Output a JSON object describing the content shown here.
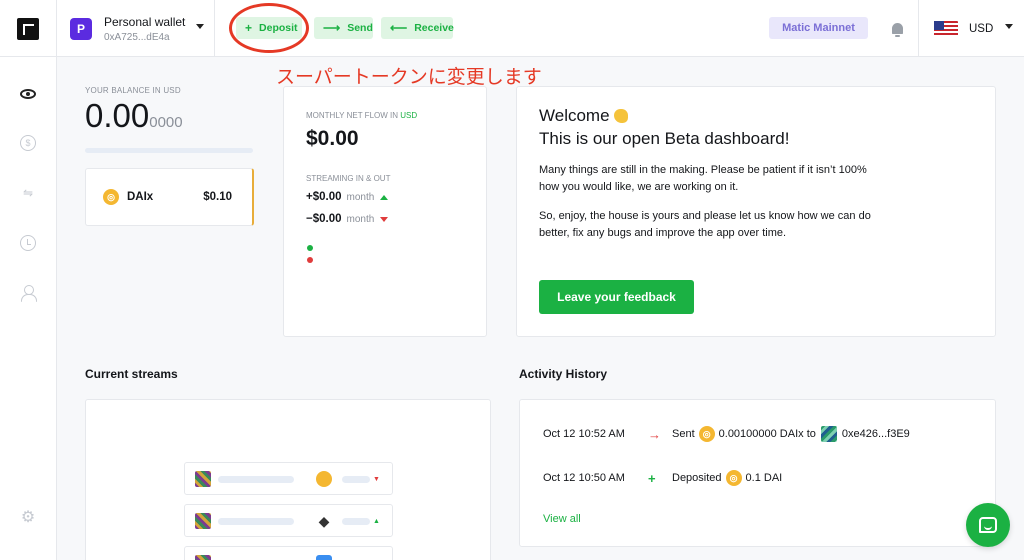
{
  "wallet": {
    "avatar_letter": "P",
    "name": "Personal wallet",
    "address": "0xA725...dE4a"
  },
  "toolbar": {
    "deposit": {
      "icon": "+",
      "label": "Deposit"
    },
    "send": {
      "icon": "⟶",
      "label": "Send"
    },
    "receive": {
      "icon": "⟵",
      "label": "Receive"
    }
  },
  "network": "Matic Mainnet",
  "currency": "USD",
  "annotation": {
    "text": "スーパートークンに変更します",
    "color": "#e53925"
  },
  "balance": {
    "label": "YOUR BALANCE IN USD",
    "main": "0.00",
    "decimals": "0000"
  },
  "token": {
    "name": "DAIx",
    "value": "$0.10"
  },
  "netflow": {
    "label": "MONTHLY NET FLOW IN",
    "currency": "USD",
    "value": "$0.00",
    "streaming_label": "STREAMING IN & OUT",
    "in_value": "+$0.00",
    "in_period": "month",
    "out_value": "−$0.00",
    "out_period": "month"
  },
  "welcome": {
    "title": "Welcome",
    "subtitle": "This is our open Beta dashboard!",
    "p1": "Many things are still in the making. Please be patient if it isn’t 100% how you would like, we are working on it.",
    "p2": "So, enjoy, the house is yours and please let us know how we can do better, fix any bugs and improve the app over time.",
    "button": "Leave your feedback"
  },
  "streams": {
    "title": "Current streams"
  },
  "activity": {
    "title": "Activity History",
    "items": [
      {
        "time": "Oct 12 10:52 AM",
        "sign": "→",
        "label": "Sent",
        "amount": "0.00100000 DAIx to",
        "address": "0xe426...f3E9"
      },
      {
        "time": "Oct 12 10:50 AM",
        "sign": "+",
        "label": "Deposited",
        "amount": "0.1 DAI"
      }
    ],
    "view_all": "View all"
  },
  "colors": {
    "accent": "#1bb143",
    "annotation": "#e53925",
    "network_bg": "#e9e7fb",
    "token_border": "#e8ad3a"
  }
}
